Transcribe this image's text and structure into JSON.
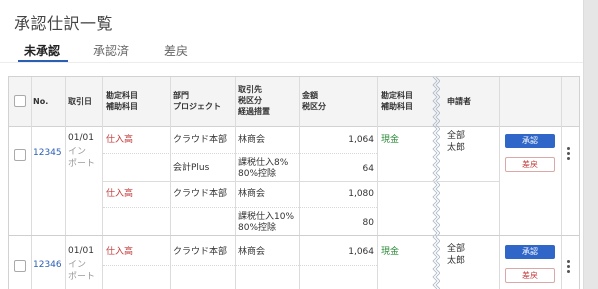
{
  "page": {
    "title": "承認仕訳一覧"
  },
  "tabs": [
    {
      "label": "未承認",
      "active": true
    },
    {
      "label": "承認済",
      "active": false
    },
    {
      "label": "差戻",
      "active": false
    }
  ],
  "table": {
    "headers": {
      "no": "No.",
      "date": "取引日",
      "debit_account": [
        "勘定科目",
        "補助科目"
      ],
      "dept": [
        "部門",
        "プロジェクト"
      ],
      "partner": [
        "取引先",
        "税区分",
        "経過措置"
      ],
      "amount": [
        "金額",
        "税区分"
      ],
      "credit_account": [
        "勘定科目",
        "補助科目"
      ],
      "applicant": "申請者"
    },
    "rows": [
      {
        "no": "12345",
        "date": "01/01",
        "source": [
          "イン",
          "ポート"
        ],
        "credit_account": "現金",
        "amount_total": "1,064",
        "applicant": [
          "全部",
          "太郎"
        ],
        "approve_label": "承認",
        "reject_label": "差戻",
        "lines": [
          {
            "account": "仕入高",
            "dept": "クラウド本部",
            "partner": "林商会",
            "amount": "1,064",
            "tax": "課税仕入8%",
            "tax2": "80%控除",
            "tax_amount": "64",
            "credit_amount": "",
            "tax_dept": "会計Plus"
          },
          {
            "account": "仕入高",
            "dept": "クラウド本部",
            "partner": "林商会",
            "amount": "1,080",
            "tax": "課税仕入10%",
            "tax2": "80%控除",
            "tax_amount": "80",
            "credit_amount": "",
            "tax_dept": ""
          }
        ],
        "credit_amount": "1,064",
        "credit_tax_amount": "64"
      },
      {
        "no": "12346",
        "date": "01/01",
        "source": [
          "イン",
          "ポート"
        ],
        "credit_account": "現金",
        "applicant": [
          "全部",
          "太郎"
        ],
        "approve_label": "承認",
        "reject_label": "差戻",
        "lines": [
          {
            "account": "仕入高",
            "dept": "クラウド本部",
            "partner": "林商会",
            "amount": "1,064"
          }
        ],
        "credit_amount": "1,064"
      }
    ]
  },
  "colors": {
    "accent": "#2f66c8",
    "link": "#2b5fb3",
    "debit": "#c43a3a",
    "credit": "#2e8b3a"
  }
}
